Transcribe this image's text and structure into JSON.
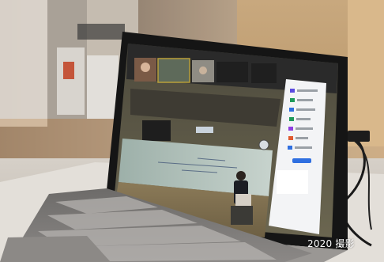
{
  "photo": {
    "caption": "2020 撮影"
  }
}
